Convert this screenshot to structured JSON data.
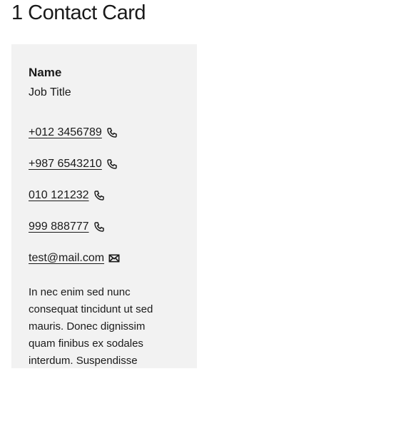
{
  "page_title": "1 Contact Card",
  "card": {
    "name": "Name",
    "job_title": "Job Title",
    "phones": [
      "+012 3456789",
      "+987 6543210",
      "010 121232",
      "999 888777"
    ],
    "email": "test@mail.com",
    "description": "In nec enim sed nunc consequat tincidunt ut sed mauris. Donec dignissim quam finibus ex sodales interdum. Suspendisse"
  }
}
